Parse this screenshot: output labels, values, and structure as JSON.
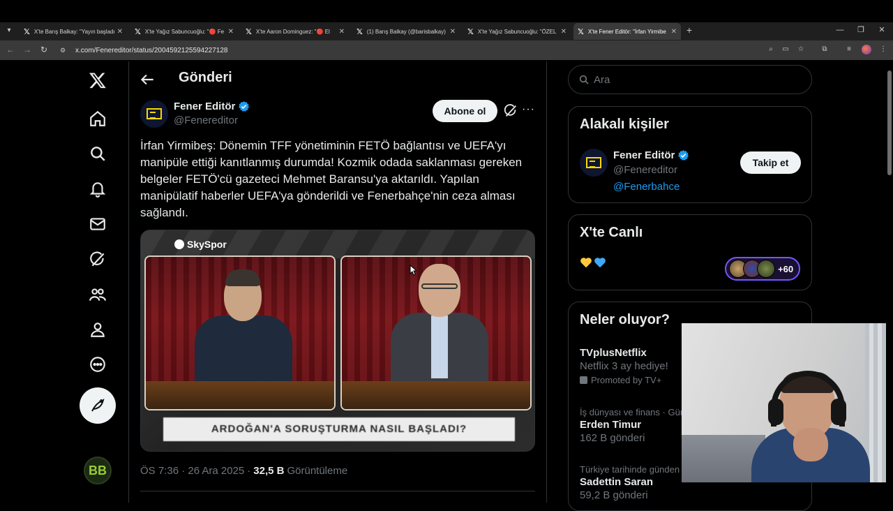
{
  "browser": {
    "tabs": [
      {
        "title": "X'te Barış Balkay: \"Yayın başladı",
        "active": false
      },
      {
        "title": "X'te Yağız Sabuncuoğlu: \"🔴 Fe",
        "active": false
      },
      {
        "title": "X'te Aaron Dominguez: \"🔴 El",
        "active": false
      },
      {
        "title": "(1) Barış Balkay (@barisbalkay) /",
        "active": false
      },
      {
        "title": "X'te Yağız Sabuncuoğlu: \"ÖZEL",
        "active": false
      },
      {
        "title": "X'te Fener Editör: \"İrfan Yirmibe",
        "active": true
      }
    ],
    "url": "x.com/Fenereditor/status/2004592125594227128"
  },
  "header": {
    "title": "Gönderi"
  },
  "post": {
    "author_name": "Fener Editör",
    "author_handle": "@Fenereditor",
    "subscribe_label": "Abone ol",
    "text": "İrfan Yirmibeş: Dönemin TFF yönetiminin FETÖ bağlantısı ve UEFA'yı manipüle ettiği kanıtlanmış durumda! Kozmik odada saklanması gereken belgeler FETÖ'cü gazeteci Mehmet Baransu'ya aktarıldı. Yapılan manipülatif haberler UEFA'ya gönderildi ve Fenerbahçe'nin ceza alması sağlandı.",
    "media": {
      "channel_logo": "SkySpor",
      "lower_third": "ARDOĞAN'A SORUŞTURMA NASIL BAŞLADI?"
    },
    "time": "ÖS 7:36 · 26 Ara 2025",
    "separator": "·",
    "views_count": "32,5 B",
    "views_label": "Görüntüleme"
  },
  "sidebar": {
    "search_placeholder": "Ara",
    "related": {
      "title": "Alakalı kişiler",
      "name": "Fener Editör",
      "handle": "@Fenereditor",
      "bio_link": "@Fenerbahce",
      "follow_label": "Takip et"
    },
    "live": {
      "title": "X'te Canlı",
      "count": "+60"
    },
    "trends": {
      "title": "Neler oluyor?",
      "items": [
        {
          "meta": "",
          "name": "TVplusNetflix",
          "sub": "Netflix 3 ay hediye!",
          "promo": "Promoted by TV+"
        },
        {
          "meta": "İş dünyası ve finans · Gün",
          "name": "Erden Timur",
          "sub": "162 B gönderi"
        },
        {
          "meta": "Türkiye tarihinde günden",
          "name": "Sadettin Saran",
          "sub": "59,2 B gönderi"
        }
      ]
    }
  },
  "colors": {
    "accent": "#1d9bf0",
    "verified": "#1d9bf0",
    "live_border": "#7856ff",
    "background": "#000000"
  }
}
